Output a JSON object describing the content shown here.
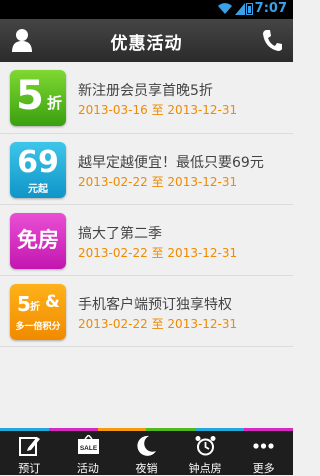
{
  "status": {
    "time": "7:07"
  },
  "header": {
    "title": "优惠活动",
    "left_icon": "user-icon",
    "right_icon": "phone-icon"
  },
  "promotions": [
    {
      "badge_big": "5",
      "badge_small": "折",
      "badge_color": "#52b820",
      "title": "新注册会员享首晚5折",
      "date_start": "2013-03-16",
      "date_sep": "至",
      "date_end": "2013-12-31"
    },
    {
      "badge_big": "69",
      "badge_small": "元起",
      "badge_color": "#21a9d9",
      "title": "越早定越便宜！最低只要69元",
      "date_start": "2013-02-22",
      "date_sep": "至",
      "date_end": "2013-12-31"
    },
    {
      "badge_big": "免房",
      "badge_color": "#d42ac0",
      "title": "搞大了第二季",
      "date_start": "2013-02-22",
      "date_sep": "至",
      "date_end": "2013-12-31"
    },
    {
      "badge_big": "5",
      "badge_mid": "折",
      "badge_amp": "&",
      "badge_small": "多一倍积分",
      "badge_color": "#f59a0c",
      "title": "手机客户端预订独享特权",
      "date_start": "2013-02-22",
      "date_sep": "至",
      "date_end": "2013-12-31"
    }
  ],
  "tabs": [
    {
      "label": "预订",
      "icon": "edit-icon"
    },
    {
      "label": "活动",
      "icon": "sale-tag-icon",
      "icon_text": "SALE"
    },
    {
      "label": "夜销",
      "icon": "moon-icon"
    },
    {
      "label": "钟点房",
      "icon": "alarm-clock-icon"
    },
    {
      "label": "更多",
      "icon": "more-dots-icon"
    }
  ],
  "colors": {
    "accent": "#f08a00",
    "header": "#333333",
    "tabbar": "#1e1e1e"
  },
  "tab_stripe_colors": [
    "#21a9d9",
    "#d42ac0",
    "#f59a0c",
    "#52b820",
    "#21a9d9",
    "#d42ac0"
  ]
}
